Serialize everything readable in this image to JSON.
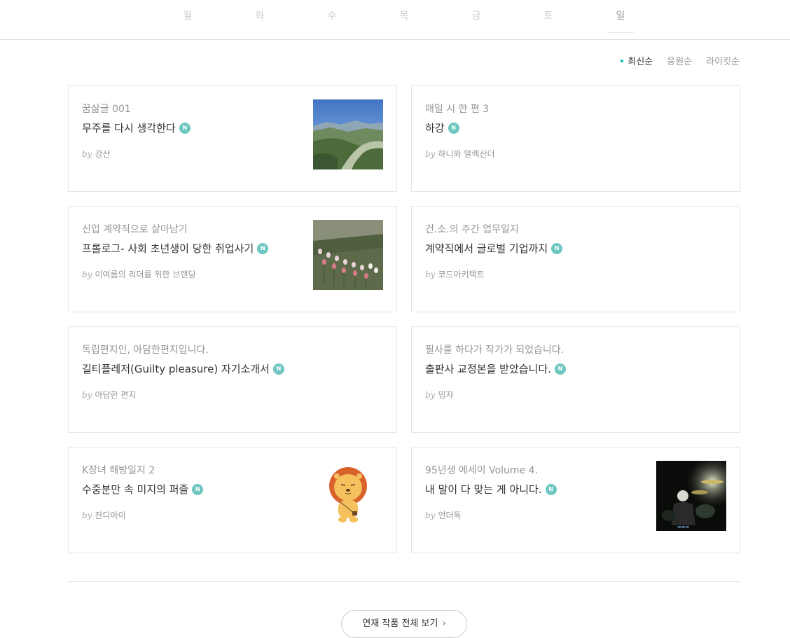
{
  "day_tabs": [
    {
      "label": "월",
      "active": false
    },
    {
      "label": "화",
      "active": false
    },
    {
      "label": "수",
      "active": false
    },
    {
      "label": "목",
      "active": false
    },
    {
      "label": "금",
      "active": false
    },
    {
      "label": "토",
      "active": false
    },
    {
      "label": "일",
      "active": true
    }
  ],
  "sort": {
    "items": [
      {
        "label": "최신순",
        "active": true
      },
      {
        "label": "응원순",
        "active": false
      },
      {
        "label": "라이킷순",
        "active": false
      }
    ]
  },
  "by_label": "by",
  "new_badge": "N",
  "cards": [
    {
      "magazine": "꿈삶글 001",
      "title": "무주를 다시 생각한다",
      "author": "강산",
      "thumb": "landscape-photo"
    },
    {
      "magazine": "매일 시 한 편 3",
      "title": "하강",
      "author": "하니와 알렉산더",
      "thumb": ""
    },
    {
      "magazine": "신입 계약직으로 살아남기",
      "title": "프롤로그- 사회 초년생이 당한 취업사기",
      "author": "이여름의 리더를 위한 브랜딩",
      "thumb": "tulip-photo"
    },
    {
      "magazine": "건.소.의 주간 업무일지",
      "title": "계약직에서 글로벌 기업까지",
      "author": "코드아키텍트",
      "thumb": ""
    },
    {
      "magazine": "독립편지인, 아담한편지입니다.",
      "title": "길티플레저(Guilty pleasure) 자기소개서",
      "author": "아담한 편지",
      "thumb": ""
    },
    {
      "magazine": "필사를 하다가 작가가 되었습니다.",
      "title": "출판사 교정본을 받았습니다.",
      "author": "밍자",
      "thumb": ""
    },
    {
      "magazine": "K장녀 해방일지 2",
      "title": "수중분만 속 미지의 퍼즐",
      "author": "잔디아이",
      "thumb": "lion-character"
    },
    {
      "magazine": "95년생 에세이 Volume 4.",
      "title": "내 말이 다 맞는 게 아니다.",
      "author": "언더독",
      "thumb": "drummer-photo"
    }
  ],
  "more_button": {
    "label": "연재 작품 전체 보기",
    "icon": "chevron-right-icon"
  },
  "colors": {
    "accent": "#00c3bd",
    "badge": "#6ec7c0",
    "border": "#e6e6e6"
  }
}
